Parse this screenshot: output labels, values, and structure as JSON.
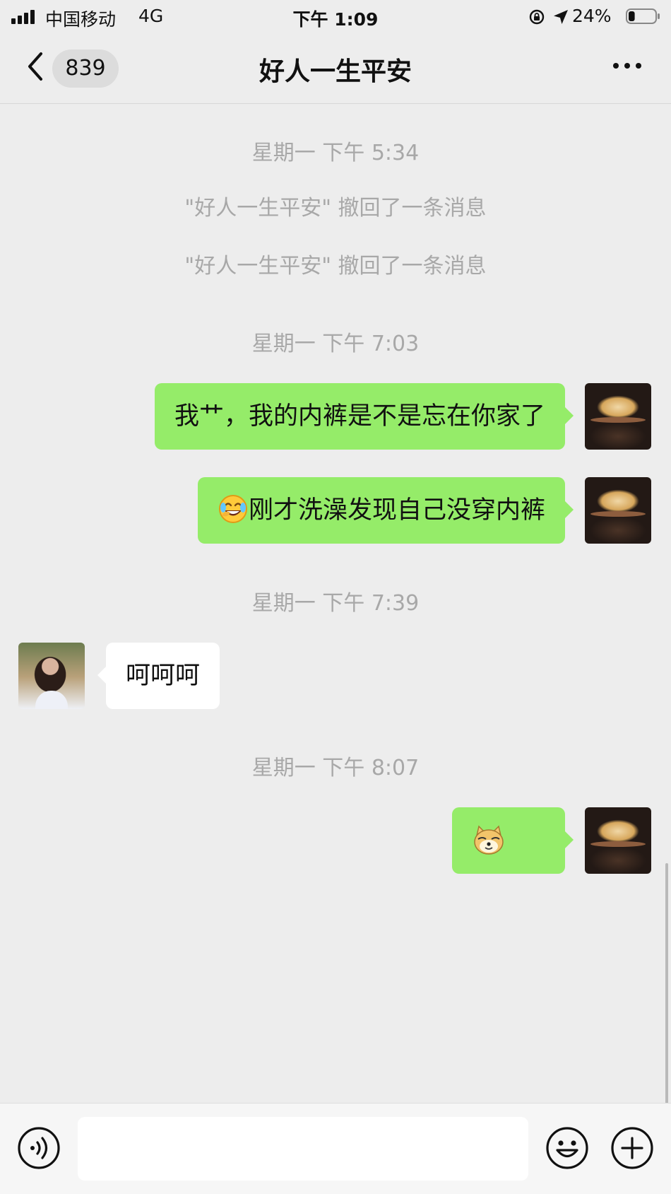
{
  "status_bar": {
    "carrier": "中国移动",
    "network": "4G",
    "time": "下午 1:09",
    "battery": "24%",
    "battery_level": 0.24,
    "icons": [
      "signal-icon",
      "rotation-lock-icon",
      "location-arrow-icon",
      "battery-icon"
    ]
  },
  "nav": {
    "unread_count": "839",
    "title": "好人一生平安",
    "icons": [
      "back-icon",
      "more-icon"
    ]
  },
  "messages": [
    {
      "type": "timestamp",
      "text": "星期一 下午 5:34"
    },
    {
      "type": "system",
      "text": "\"好人一生平安\" 撤回了一条消息"
    },
    {
      "type": "system",
      "text": "\"好人一生平安\" 撤回了一条消息"
    },
    {
      "type": "timestamp",
      "text": "星期一 下午 7:03"
    },
    {
      "type": "outgoing",
      "text": "我艹，我的内裤是不是忘在你家了"
    },
    {
      "type": "outgoing",
      "emoji": "laughing-crying-emoji-icon",
      "text": "刚才洗澡发现自己没穿内裤"
    },
    {
      "type": "timestamp",
      "text": "星期一 下午 7:39"
    },
    {
      "type": "incoming",
      "text": "呵呵呵"
    },
    {
      "type": "timestamp",
      "text": "星期一 下午 8:07"
    },
    {
      "type": "outgoing-sticker",
      "sticker": "doge-sticker-icon"
    }
  ],
  "input": {
    "placeholder": "",
    "icons": [
      "voice-icon",
      "emoji-face-icon",
      "plus-icon"
    ]
  },
  "colors": {
    "background": "#ededed",
    "outgoing_bubble": "#95ec69",
    "incoming_bubble": "#ffffff",
    "muted_text": "#a8a8a8"
  }
}
